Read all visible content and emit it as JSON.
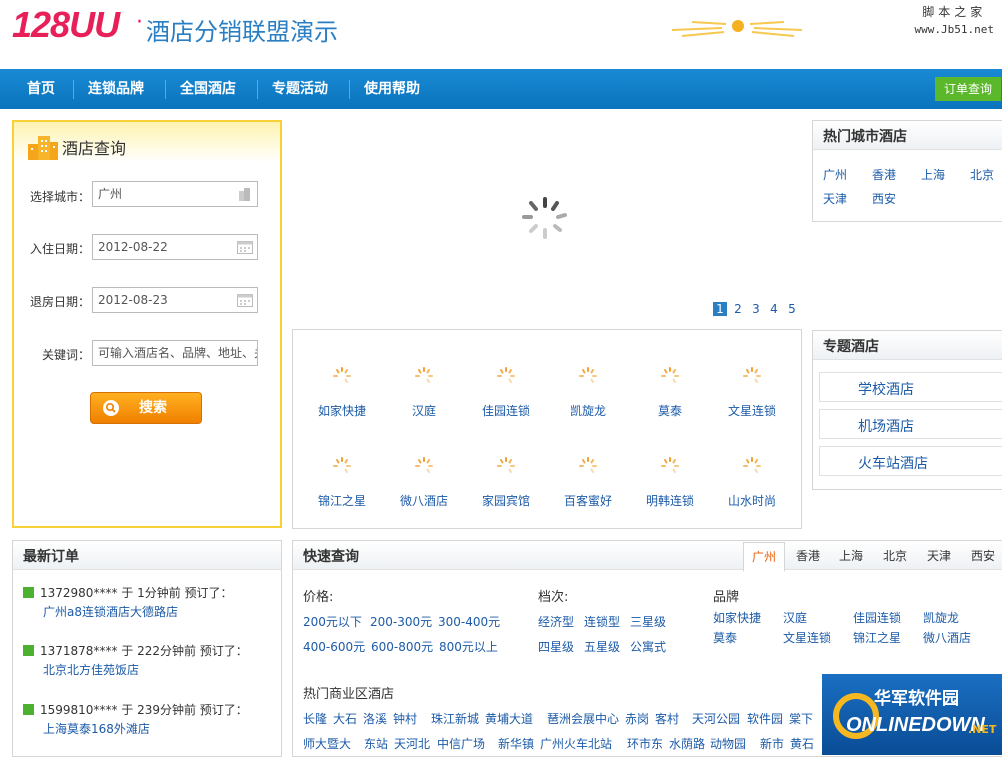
{
  "header": {
    "logo_number": "128UU",
    "logo_title": "酒店分销联盟演示",
    "watermark_line1": "脚本之家",
    "watermark_line2": "www.Jb51.net"
  },
  "nav": {
    "items": [
      "首页",
      "连锁品牌",
      "全国酒店",
      "专题活动",
      "使用帮助"
    ],
    "order_query": "订单查询"
  },
  "search": {
    "title": "酒店查询",
    "city_label": "选择城市：",
    "city_value": "广州",
    "checkin_label": "入住日期：",
    "checkin_value": "2012-08-22",
    "checkout_label": "退房日期：",
    "checkout_value": "2012-08-23",
    "keyword_label": "关键词：",
    "keyword_placeholder": "可输入酒店名、品牌、地址、关",
    "button": "搜索"
  },
  "carousel": {
    "pages": [
      "1",
      "2",
      "3",
      "4",
      "5"
    ],
    "active_page": "1"
  },
  "brands": [
    "如家快捷",
    "汉庭",
    "佳园连锁",
    "凯旋龙",
    "莫泰",
    "文星连锁",
    "锦江之星",
    "微八酒店",
    "家园宾馆",
    "百客蜜好",
    "明韩连锁",
    "山水时尚"
  ],
  "hot_cities": {
    "title": "热门城市酒店",
    "cities": [
      "广州",
      "香港",
      "上海",
      "北京",
      "天津",
      "西安"
    ]
  },
  "topics": {
    "title": "专题酒店",
    "items": [
      "学校酒店",
      "机场酒店",
      "火车站酒店"
    ]
  },
  "orders": {
    "title": "最新订单",
    "items": [
      {
        "line1": "1372980**** 于 1分钟前 预订了：",
        "hotel": "广州a8连锁酒店大德路店"
      },
      {
        "line1": "1371878**** 于 222分钟前 预订了：",
        "hotel": "北京北方佳苑饭店"
      },
      {
        "line1": "1599810**** 于 239分钟前 预订了：",
        "hotel": "上海莫泰168外滩店"
      }
    ]
  },
  "quick": {
    "title": "快速查询",
    "tabs": [
      "广州",
      "香港",
      "上海",
      "北京",
      "天津",
      "西安"
    ],
    "price_label": "价格:",
    "prices": [
      "200元以下",
      "200-300元",
      "300-400元",
      "400-600元",
      "600-800元",
      "800元以上"
    ],
    "grade_label": "档次:",
    "grades": [
      "经济型",
      "连锁型",
      "三星级",
      "四星级",
      "五星级",
      "公寓式"
    ],
    "brand_label": "品牌",
    "brand_links": [
      "如家快捷",
      "汉庭",
      "佳园连锁",
      "凯旋龙",
      "莫泰",
      "文星连锁",
      "锦江之星",
      "微八酒店"
    ],
    "district_label": "热门商业区酒店",
    "district_row1": [
      "长隆",
      "大石",
      "洛溪",
      "钟村",
      "珠江新城",
      "黄埔大道",
      "琶洲会展中心",
      "赤岗",
      "客村",
      "天河公园",
      "软件园",
      "棠下"
    ],
    "district_row2": [
      "师大暨大",
      "东站",
      "天河北",
      "中信广场",
      "新华镇",
      "广州火车北站",
      "环市东",
      "水荫路",
      "动物园",
      "新市",
      "黄石"
    ]
  },
  "badge": {
    "line1": "华军软件园",
    "line2": "ONLINEDOWN",
    "line3": ".NET"
  }
}
